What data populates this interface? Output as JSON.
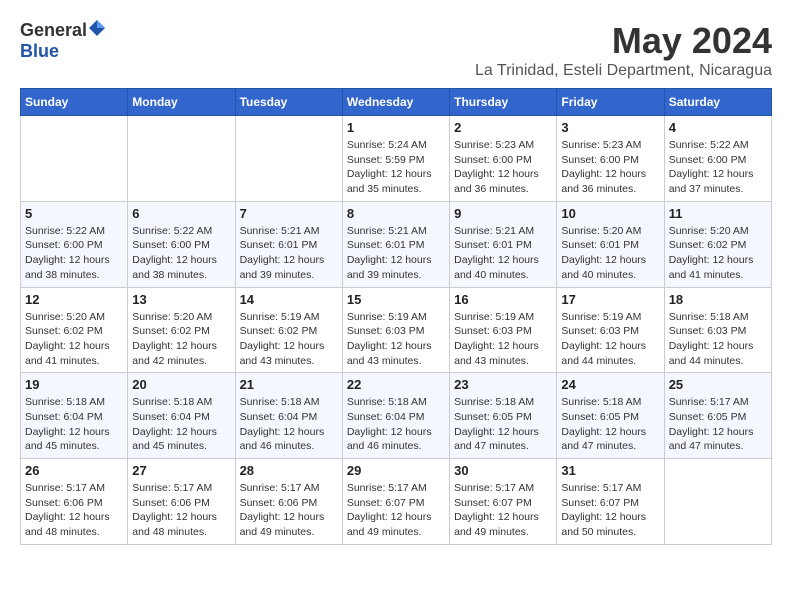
{
  "logo": {
    "general": "General",
    "blue": "Blue"
  },
  "title": {
    "month": "May 2024",
    "location": "La Trinidad, Esteli Department, Nicaragua"
  },
  "days_of_week": [
    "Sunday",
    "Monday",
    "Tuesday",
    "Wednesday",
    "Thursday",
    "Friday",
    "Saturday"
  ],
  "weeks": [
    [
      {
        "day": "",
        "sunrise": "",
        "sunset": "",
        "daylight": ""
      },
      {
        "day": "",
        "sunrise": "",
        "sunset": "",
        "daylight": ""
      },
      {
        "day": "",
        "sunrise": "",
        "sunset": "",
        "daylight": ""
      },
      {
        "day": "1",
        "sunrise": "Sunrise: 5:24 AM",
        "sunset": "Sunset: 5:59 PM",
        "daylight": "Daylight: 12 hours and 35 minutes."
      },
      {
        "day": "2",
        "sunrise": "Sunrise: 5:23 AM",
        "sunset": "Sunset: 6:00 PM",
        "daylight": "Daylight: 12 hours and 36 minutes."
      },
      {
        "day": "3",
        "sunrise": "Sunrise: 5:23 AM",
        "sunset": "Sunset: 6:00 PM",
        "daylight": "Daylight: 12 hours and 36 minutes."
      },
      {
        "day": "4",
        "sunrise": "Sunrise: 5:22 AM",
        "sunset": "Sunset: 6:00 PM",
        "daylight": "Daylight: 12 hours and 37 minutes."
      }
    ],
    [
      {
        "day": "5",
        "sunrise": "Sunrise: 5:22 AM",
        "sunset": "Sunset: 6:00 PM",
        "daylight": "Daylight: 12 hours and 38 minutes."
      },
      {
        "day": "6",
        "sunrise": "Sunrise: 5:22 AM",
        "sunset": "Sunset: 6:00 PM",
        "daylight": "Daylight: 12 hours and 38 minutes."
      },
      {
        "day": "7",
        "sunrise": "Sunrise: 5:21 AM",
        "sunset": "Sunset: 6:01 PM",
        "daylight": "Daylight: 12 hours and 39 minutes."
      },
      {
        "day": "8",
        "sunrise": "Sunrise: 5:21 AM",
        "sunset": "Sunset: 6:01 PM",
        "daylight": "Daylight: 12 hours and 39 minutes."
      },
      {
        "day": "9",
        "sunrise": "Sunrise: 5:21 AM",
        "sunset": "Sunset: 6:01 PM",
        "daylight": "Daylight: 12 hours and 40 minutes."
      },
      {
        "day": "10",
        "sunrise": "Sunrise: 5:20 AM",
        "sunset": "Sunset: 6:01 PM",
        "daylight": "Daylight: 12 hours and 40 minutes."
      },
      {
        "day": "11",
        "sunrise": "Sunrise: 5:20 AM",
        "sunset": "Sunset: 6:02 PM",
        "daylight": "Daylight: 12 hours and 41 minutes."
      }
    ],
    [
      {
        "day": "12",
        "sunrise": "Sunrise: 5:20 AM",
        "sunset": "Sunset: 6:02 PM",
        "daylight": "Daylight: 12 hours and 41 minutes."
      },
      {
        "day": "13",
        "sunrise": "Sunrise: 5:20 AM",
        "sunset": "Sunset: 6:02 PM",
        "daylight": "Daylight: 12 hours and 42 minutes."
      },
      {
        "day": "14",
        "sunrise": "Sunrise: 5:19 AM",
        "sunset": "Sunset: 6:02 PM",
        "daylight": "Daylight: 12 hours and 43 minutes."
      },
      {
        "day": "15",
        "sunrise": "Sunrise: 5:19 AM",
        "sunset": "Sunset: 6:03 PM",
        "daylight": "Daylight: 12 hours and 43 minutes."
      },
      {
        "day": "16",
        "sunrise": "Sunrise: 5:19 AM",
        "sunset": "Sunset: 6:03 PM",
        "daylight": "Daylight: 12 hours and 43 minutes."
      },
      {
        "day": "17",
        "sunrise": "Sunrise: 5:19 AM",
        "sunset": "Sunset: 6:03 PM",
        "daylight": "Daylight: 12 hours and 44 minutes."
      },
      {
        "day": "18",
        "sunrise": "Sunrise: 5:18 AM",
        "sunset": "Sunset: 6:03 PM",
        "daylight": "Daylight: 12 hours and 44 minutes."
      }
    ],
    [
      {
        "day": "19",
        "sunrise": "Sunrise: 5:18 AM",
        "sunset": "Sunset: 6:04 PM",
        "daylight": "Daylight: 12 hours and 45 minutes."
      },
      {
        "day": "20",
        "sunrise": "Sunrise: 5:18 AM",
        "sunset": "Sunset: 6:04 PM",
        "daylight": "Daylight: 12 hours and 45 minutes."
      },
      {
        "day": "21",
        "sunrise": "Sunrise: 5:18 AM",
        "sunset": "Sunset: 6:04 PM",
        "daylight": "Daylight: 12 hours and 46 minutes."
      },
      {
        "day": "22",
        "sunrise": "Sunrise: 5:18 AM",
        "sunset": "Sunset: 6:04 PM",
        "daylight": "Daylight: 12 hours and 46 minutes."
      },
      {
        "day": "23",
        "sunrise": "Sunrise: 5:18 AM",
        "sunset": "Sunset: 6:05 PM",
        "daylight": "Daylight: 12 hours and 47 minutes."
      },
      {
        "day": "24",
        "sunrise": "Sunrise: 5:18 AM",
        "sunset": "Sunset: 6:05 PM",
        "daylight": "Daylight: 12 hours and 47 minutes."
      },
      {
        "day": "25",
        "sunrise": "Sunrise: 5:17 AM",
        "sunset": "Sunset: 6:05 PM",
        "daylight": "Daylight: 12 hours and 47 minutes."
      }
    ],
    [
      {
        "day": "26",
        "sunrise": "Sunrise: 5:17 AM",
        "sunset": "Sunset: 6:06 PM",
        "daylight": "Daylight: 12 hours and 48 minutes."
      },
      {
        "day": "27",
        "sunrise": "Sunrise: 5:17 AM",
        "sunset": "Sunset: 6:06 PM",
        "daylight": "Daylight: 12 hours and 48 minutes."
      },
      {
        "day": "28",
        "sunrise": "Sunrise: 5:17 AM",
        "sunset": "Sunset: 6:06 PM",
        "daylight": "Daylight: 12 hours and 49 minutes."
      },
      {
        "day": "29",
        "sunrise": "Sunrise: 5:17 AM",
        "sunset": "Sunset: 6:07 PM",
        "daylight": "Daylight: 12 hours and 49 minutes."
      },
      {
        "day": "30",
        "sunrise": "Sunrise: 5:17 AM",
        "sunset": "Sunset: 6:07 PM",
        "daylight": "Daylight: 12 hours and 49 minutes."
      },
      {
        "day": "31",
        "sunrise": "Sunrise: 5:17 AM",
        "sunset": "Sunset: 6:07 PM",
        "daylight": "Daylight: 12 hours and 50 minutes."
      },
      {
        "day": "",
        "sunrise": "",
        "sunset": "",
        "daylight": ""
      }
    ]
  ]
}
